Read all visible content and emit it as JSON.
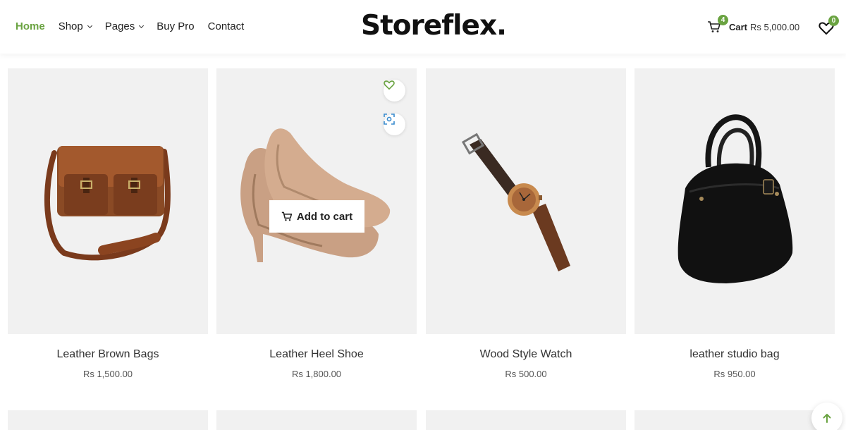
{
  "header": {
    "nav": [
      {
        "label": "Home",
        "active": true
      },
      {
        "label": "Shop",
        "dropdown": true
      },
      {
        "label": "Pages",
        "dropdown": true
      },
      {
        "label": "Buy Pro"
      },
      {
        "label": "Contact"
      }
    ],
    "logo": "Storeflex.",
    "cart": {
      "count": "4",
      "label": "Cart",
      "amount": "Rs 5,000.00"
    },
    "wishlist": {
      "count": "0"
    }
  },
  "products": [
    {
      "title": "Leather Brown Bags",
      "price": "Rs 1,500.00",
      "image": "brown-messenger-bag"
    },
    {
      "title": "Leather Heel Shoe",
      "price": "Rs 1,800.00",
      "image": "beige-heel-shoes",
      "hover": true,
      "add_to_cart": "Add to cart"
    },
    {
      "title": "Wood Style Watch",
      "price": "Rs 500.00",
      "image": "wooden-watch"
    },
    {
      "title": "leather studio bag",
      "price": "Rs 950.00",
      "image": "black-leather-handbag"
    }
  ],
  "colors": {
    "accent": "#6aa341",
    "card_bg": "#f1f1f1",
    "focus_icon": "#3a8ccf"
  },
  "icons": [
    "cart-icon",
    "heart-icon",
    "chevron-down-icon",
    "focus-scan-icon",
    "arrow-up-icon"
  ]
}
